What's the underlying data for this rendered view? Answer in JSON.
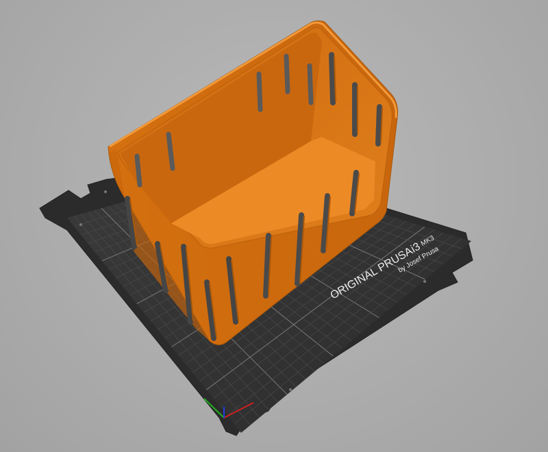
{
  "bed": {
    "brand": "ORIGINAL PRUSA",
    "model": "i3",
    "version": "MK3",
    "byline": "by Josef Prusa"
  },
  "model": {
    "color": "#e07a14",
    "shade_color": "#a9580b",
    "highlight_color": "#f0922e"
  },
  "axes": {
    "x_color": "#d02020",
    "y_color": "#20b020",
    "z_color": "#2040e0"
  }
}
